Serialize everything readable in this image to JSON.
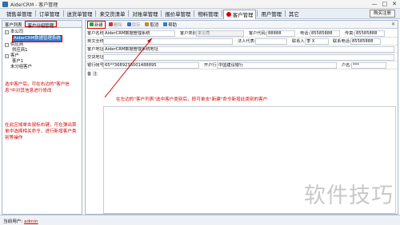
{
  "window": {
    "title": "AiderCRM - 客户管理",
    "minimize": "—",
    "maximize": "□",
    "close": "✕"
  },
  "menu": {
    "items": [
      "销售单管理",
      "订单管理",
      "送货单管理",
      "来交货清单",
      "对账单管理",
      "报价单管理",
      "物料管理",
      "客户管理",
      "用户管理",
      "其它"
    ],
    "active_index": 7,
    "exit_label": "购买注册"
  },
  "left_panel": {
    "tabs": [
      "客户列表",
      "客户分组管理"
    ],
    "tree": [
      {
        "label": "本公司",
        "level": 0,
        "expander": "-"
      },
      {
        "label": "AiderCRM数据管理系统",
        "level": 1,
        "selected": true
      },
      {
        "label": "供应商",
        "level": 0,
        "expander": "-"
      },
      {
        "label": "供应商1",
        "level": 1
      },
      {
        "label": "客户",
        "level": 0,
        "expander": "-"
      },
      {
        "label": "客户1",
        "level": 1
      },
      {
        "label": "未分组客户",
        "level": 0
      }
    ]
  },
  "annotations": {
    "left_top": "选中客户后，可在右边的\"客户信息\"中对其信息进行修改",
    "left_bottom": "在此区域单击鼠标右键，可在弹出菜单中选择相关命令，进行新增客户类别等操作",
    "main": "在左边的\"客户列表\"选中客户类别后，即可单击\"新建\"命令新增此类别的客户"
  },
  "toolbar": {
    "buttons": [
      {
        "label": "新建",
        "highlight": true,
        "icon": "new-icon",
        "color": "#3a9a3a"
      },
      {
        "label": "删除",
        "disabled": true,
        "icon": "delete-icon",
        "color": "#cc3333"
      },
      {
        "label": "保存",
        "disabled": true,
        "icon": "save-icon",
        "color": "#3a6fc0"
      },
      {
        "label": "取消",
        "icon": "cancel-icon",
        "color": "#c08a2a"
      },
      {
        "label": "帮助",
        "icon": "help-icon",
        "color": "#2a7fc0"
      }
    ],
    "close": "✕"
  },
  "form": {
    "customer_name_label": "客户名称:",
    "customer_name": "AiderCRM数据管理系统",
    "category_label": "客户类别:",
    "category": "本公司",
    "code_label": "客户代码:",
    "code": "88888",
    "phone_label": "电话:",
    "phone": "85585888",
    "fax_label": "传真:",
    "fax": "85585888",
    "full_name_label": "英文全称:",
    "full_name": "",
    "legal_label": "法人代表:",
    "legal": "",
    "contact_label": "联系人:",
    "contact": "李 X",
    "contact_phone_label": "联系电话:",
    "contact_phone": "85585888",
    "address_label": "客户地址:",
    "address": "AiderCRM数据管理系统地址",
    "delivery_label": "交货地址:",
    "delivery": "",
    "account_label": "银行帐号:",
    "account": "65**3689236001488895",
    "bank_label": "开户行:",
    "bank": "中国建设银行",
    "account_name_label": "户名:",
    "account_name": "***",
    "notes_label": "备    注:"
  },
  "status": {
    "label": "当前用户:",
    "user": "admin"
  },
  "watermark": "软件技巧",
  "colors": {
    "highlight": "#d40000",
    "selected": "#3a78c9",
    "menubar": "#e9eef5"
  }
}
